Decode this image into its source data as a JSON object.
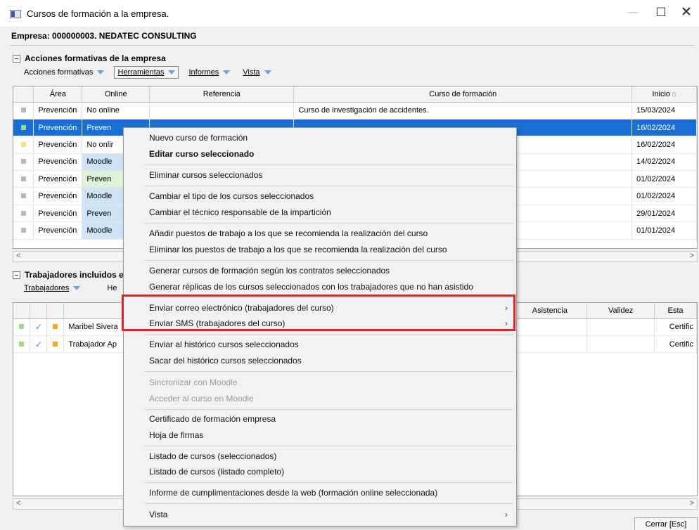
{
  "window": {
    "title": "Cursos de formación a la empresa."
  },
  "company": "Empresa:  000000003. NEDATEC CONSULTING",
  "section1": {
    "title": "Acciones formativas de la empresa",
    "toolbar": [
      "Acciones formativas",
      "Herramientas",
      "Informes",
      "Vista"
    ]
  },
  "courses": {
    "columns": [
      "Área",
      "Online",
      "Referencia",
      "Curso de formación",
      "Inicio"
    ],
    "rows": [
      {
        "area": "Prevención",
        "online": "No online",
        "curso": "Curso de investigación de accidentes.",
        "inicio": "15/03/2024"
      },
      {
        "area": "Prevención",
        "online": "Preven",
        "curso": "",
        "inicio": "16/02/2024"
      },
      {
        "area": "Prevención",
        "online": "No onlir",
        "curso": "",
        "inicio": "16/02/2024"
      },
      {
        "area": "Prevención",
        "online": "Moodle",
        "curso": "",
        "inicio": "14/02/2024"
      },
      {
        "area": "Prevención",
        "online": "Preven",
        "curso": "",
        "inicio": "01/02/2024"
      },
      {
        "area": "Prevención",
        "online": "Moodle",
        "curso": "",
        "inicio": "01/02/2024"
      },
      {
        "area": "Prevención",
        "online": "Preven",
        "curso": "",
        "inicio": "29/01/2024"
      },
      {
        "area": "Prevención",
        "online": "Moodle",
        "curso": "",
        "inicio": "01/01/2024"
      }
    ]
  },
  "section2": {
    "title": "Trabajadores incluidos e",
    "toolbar": [
      "Trabajadores",
      "He"
    ]
  },
  "workers": {
    "columns": [
      "Asistencia",
      "Validez",
      "Esta"
    ],
    "rows": [
      {
        "name": "Maribel Sivera",
        "estado": "Certific"
      },
      {
        "name": "Trabajador Ap",
        "estado": "Certific"
      }
    ]
  },
  "context_menu": {
    "items": [
      {
        "label": "Nuevo curso de formación"
      },
      {
        "label": "Editar curso seleccionado"
      },
      {
        "label": "Eliminar cursos seleccionados"
      },
      {
        "label": "Cambiar el tipo de los cursos seleccionados"
      },
      {
        "label": "Cambiar el técnico responsable de la impartición"
      },
      {
        "label": "Añadir puestos de trabajo a los que se recomienda la realización del curso"
      },
      {
        "label": "Eliminar los puestos de trabajo a los que se recomienda la realización del curso"
      },
      {
        "label": "Generar cursos de formación según los contratos seleccionados"
      },
      {
        "label": "Generar réplicas de los cursos seleccionados con los trabajadores que no han asistido"
      },
      {
        "label": "Enviar correo electrónico (trabajadores del curso)"
      },
      {
        "label": "Enviar SMS (trabajadores del curso)"
      },
      {
        "label": "Enviar al histórico cursos seleccionados"
      },
      {
        "label": "Sacar del histórico cursos seleccionados"
      },
      {
        "label": "Sincronizar con Moodle"
      },
      {
        "label": "Acceder al curso en Moodle"
      },
      {
        "label": "Certificado de formación empresa"
      },
      {
        "label": "Hoja de firmas"
      },
      {
        "label": "Listado de cursos (seleccionados)"
      },
      {
        "label": "Listado de cursos (listado completo)"
      },
      {
        "label": "Informe de cumplimentaciones desde la web (formación online seleccionada)"
      },
      {
        "label": "Vista"
      }
    ]
  },
  "close_button": "Cerrar [Esc]",
  "colors": {
    "selection": "#1a6fd6",
    "highlight": "#e0232f"
  }
}
